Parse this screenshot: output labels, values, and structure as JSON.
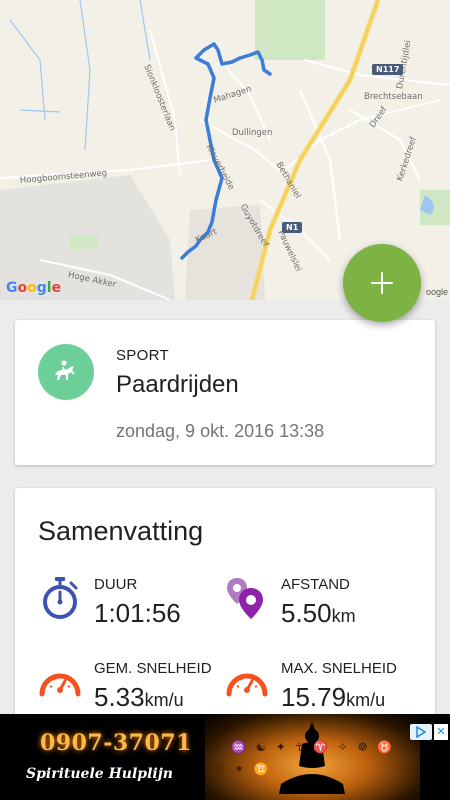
{
  "map": {
    "labels": {
      "hoogboomsteenweg": "Hoogboomsteenweg",
      "hoge_akker": "Hoge Akker",
      "sionkloosterlaan": "Sionkloosterlaan",
      "mahagen": "Mahagen",
      "dullingen": "Dullingen",
      "klaverheide": "Klaverheide",
      "bethaniel": "Bethaniel",
      "guyotdreef": "Guyotdreef",
      "kaart": "Kaart",
      "pauwelslei": "Pauwelslei",
      "brechtsebaan": "Brechtsebaan",
      "dreef": "Dreef",
      "dorentijdlei": "Durentijdlei",
      "kerkedreef": "Kerkedreef"
    },
    "shields": {
      "n117": "N117",
      "n1": "N1"
    },
    "attribution": "Google",
    "credit": "M",
    "credit_right": "oogle",
    "route_color": "#3b7dd8"
  },
  "fab": {
    "icon": "plus-icon",
    "color": "#7cb342"
  },
  "sport_card": {
    "heading": "SPORT",
    "name": "Paardrijden",
    "datetime": "zondag, 9 okt. 2016 13:38",
    "icon": "horse-rider-icon",
    "icon_color": "#6ccf9a"
  },
  "summary": {
    "title": "Samenvatting",
    "duration": {
      "label": "DUUR",
      "value": "1:01:56",
      "unit": "",
      "icon": "stopwatch-icon",
      "color": "#3f51b5"
    },
    "distance": {
      "label": "AFSTAND",
      "value": "5.50",
      "unit": "km",
      "icon": "location-pins-icon",
      "color": "#8e44ad"
    },
    "avg_speed": {
      "label": "GEM. SNELHEID",
      "value": "5.33",
      "unit": "km/u",
      "icon": "speedometer-icon",
      "color": "#f4511e"
    },
    "max_speed": {
      "label": "MAX. SNELHEID",
      "value": "15.79",
      "unit": "km/u",
      "icon": "speedometer-icon",
      "color": "#f4511e"
    }
  },
  "ad": {
    "phone": "0907-37071",
    "tagline": "Spirituele Hulplijn",
    "glyphs": "☤ ♒ ☯ ✦ ☥ ♈ ✧ ☸ ♉ ☉ ✶ ♊",
    "close": "✕"
  }
}
